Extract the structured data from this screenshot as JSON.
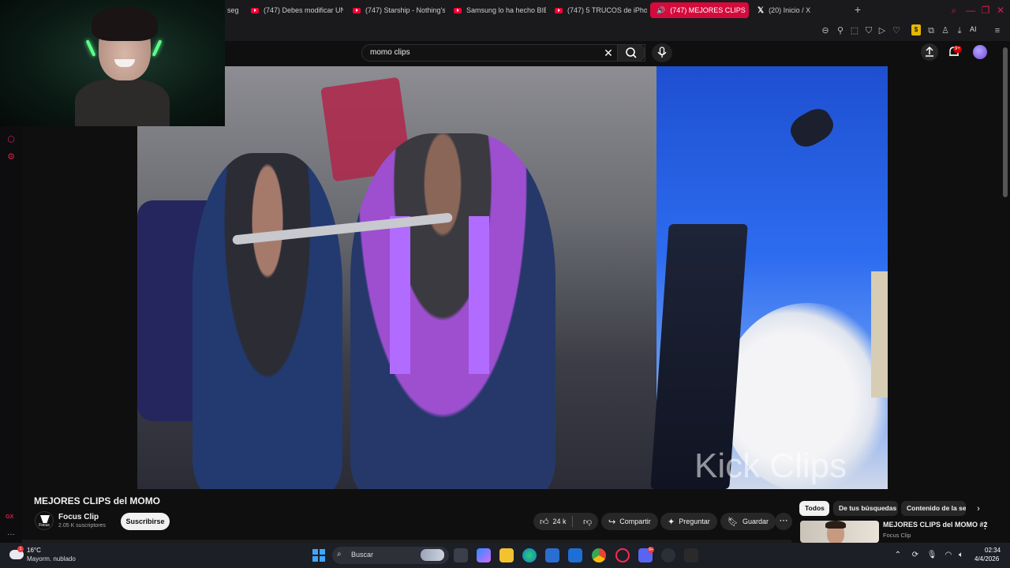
{
  "browser": {
    "tabs": [
      {
        "label": "seg"
      },
      {
        "label": "(747) Debes modificar UN"
      },
      {
        "label": "(747) Starship - Nothing's"
      },
      {
        "label": "Samsung lo ha hecho BIE"
      },
      {
        "label": "(747) 5 TRUCOS de iPhon"
      },
      {
        "label": "(747) MEJORES CLIPS"
      },
      {
        "label": "(20) Inicio / X"
      }
    ],
    "toolbar_ai_label": "AI",
    "extension_badge": "$"
  },
  "sidebar": {
    "gx_label": "GX",
    "more_label": "···"
  },
  "youtube": {
    "search": {
      "value": "momo clips"
    },
    "notifications_badge": "9+",
    "video": {
      "watermark": "Kick Clips",
      "title": "MEJORES CLIPS del MOMO"
    },
    "channel": {
      "logo_text": "Focus clip",
      "name": "Focus Clip",
      "subscribers": "2.05 K suscriptores",
      "subscribe_label": "Suscribirse"
    },
    "actions": {
      "likes": "24 k",
      "share": "Compartir",
      "ask": "Preguntar",
      "save": "Guardar"
    },
    "chips": [
      "Todos",
      "De tus búsquedas",
      "Contenido de la ser"
    ],
    "recommendation": {
      "title": "MEJORES CLIPS del MOMO #2",
      "channel": "Focus Clip"
    }
  },
  "taskbar": {
    "weather_badge": "1",
    "temperature": "16°C",
    "condition": "Mayorm. nublado",
    "search_label": "Buscar",
    "discord_badge": "9+",
    "time": "02:34",
    "date": "4/4/2026"
  },
  "colors": {
    "accent": "#d40b3c",
    "opera_red": "#d42048",
    "youtube_bg": "#0f0f0f",
    "pill_bg": "#272727"
  }
}
